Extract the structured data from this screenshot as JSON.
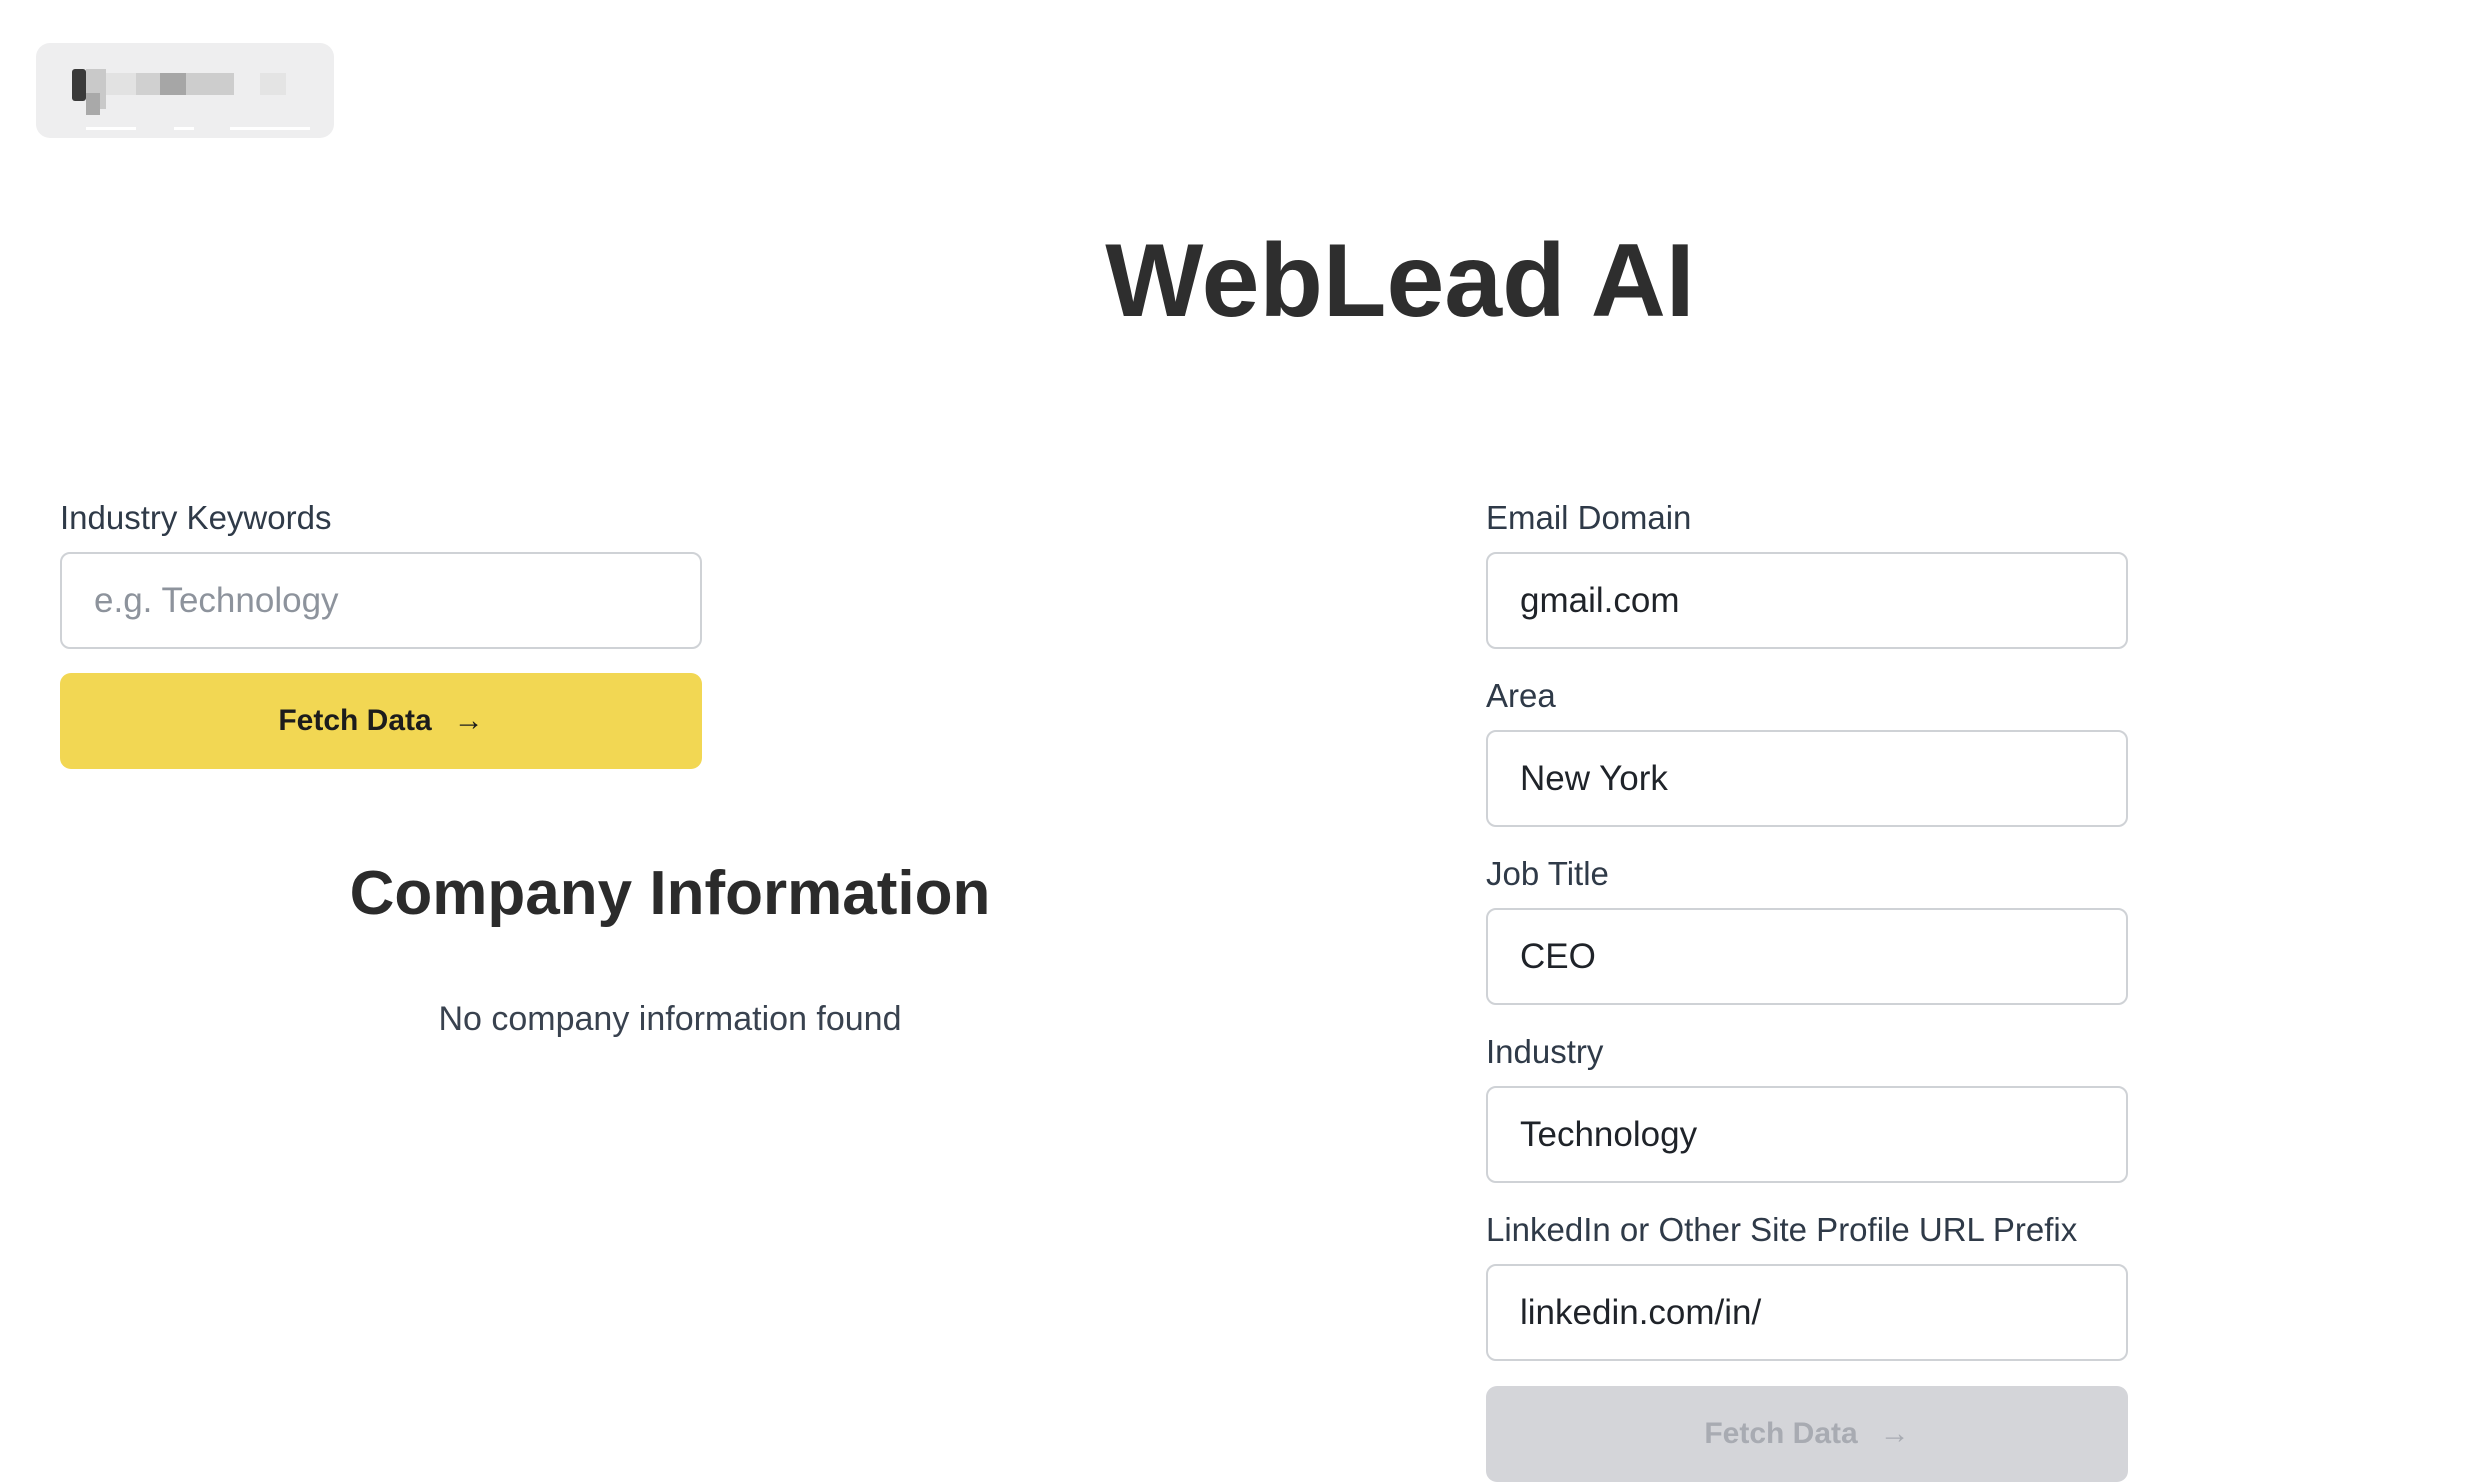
{
  "app": {
    "title": "WebLead AI"
  },
  "left_panel": {
    "industry_keywords": {
      "label": "Industry Keywords",
      "value": "",
      "placeholder": "e.g. Technology"
    },
    "fetch_button": {
      "label": "Fetch Data",
      "arrow": "→"
    },
    "company_section": {
      "title": "Company Information",
      "empty_message": "No company information found"
    }
  },
  "right_panel": {
    "email_domain": {
      "label": "Email Domain",
      "value": "gmail.com"
    },
    "area": {
      "label": "Area",
      "value": "New York"
    },
    "job_title": {
      "label": "Job Title",
      "value": "CEO"
    },
    "industry": {
      "label": "Industry",
      "value": "Technology"
    },
    "profile_url_prefix": {
      "label": "LinkedIn or Other Site Profile URL Prefix",
      "value": "linkedin.com/in/"
    },
    "fetch_button": {
      "label": "Fetch Data",
      "arrow": "→",
      "disabled": true
    }
  },
  "colors": {
    "accent_button": "#f2d753",
    "disabled_button": "#d4d5d9",
    "title_text": "#2e2e2e"
  }
}
